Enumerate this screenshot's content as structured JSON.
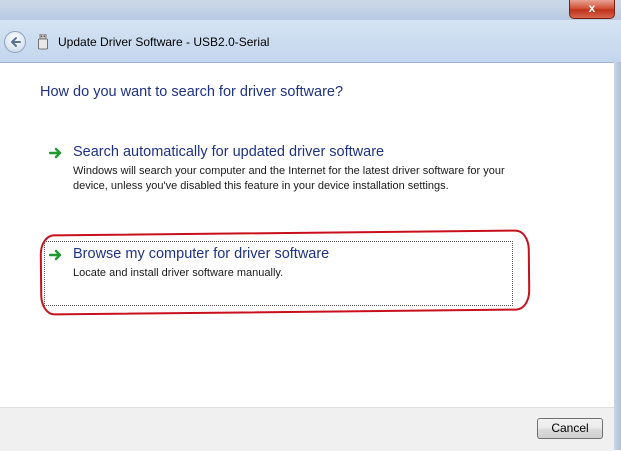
{
  "window": {
    "title": "Update Driver Software - USB2.0-Serial",
    "close_label": "x"
  },
  "heading": "How do you want to search for driver software?",
  "options": [
    {
      "title": "Search automatically for updated driver software",
      "description": "Windows will search your computer and the Internet for the latest driver software for your device, unless you've disabled this feature in your device installation settings."
    },
    {
      "title": "Browse my computer for driver software",
      "description": "Locate and install driver software manually."
    }
  ],
  "footer": {
    "cancel_label": "Cancel"
  },
  "icons": {
    "option_arrow": "green-right-arrow-icon",
    "back": "back-arrow-icon",
    "device": "usb-device-icon"
  },
  "colors": {
    "heading": "#1e3287",
    "arrow": "#1f9a2f",
    "highlight": "#c8101c"
  }
}
